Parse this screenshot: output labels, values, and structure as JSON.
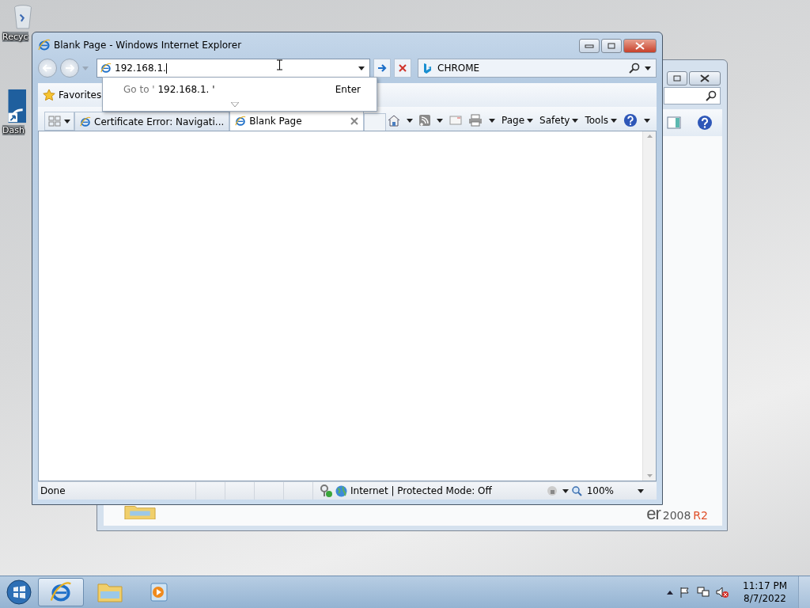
{
  "desktop": {
    "icons": [
      {
        "kind": "recycle",
        "label": "Recyc"
      },
      {
        "kind": "dashboard",
        "label": "Dash"
      }
    ]
  },
  "background_window": {
    "logo": {
      "partial_word": "er",
      "version": "2008",
      "release": "R2"
    }
  },
  "browser": {
    "title": "Blank Page - Windows Internet Explorer",
    "address": {
      "value": "192.168.1."
    },
    "suggestion": {
      "prefix": "Go to '",
      "address": "192.168.1. '",
      "hint": "Enter"
    },
    "search": {
      "value": "CHROME"
    },
    "favorites": "Favorites",
    "tabs": [
      {
        "label": "Certificate Error: Navigati...",
        "selected": false
      },
      {
        "label": "Blank Page",
        "selected": true
      }
    ],
    "commands": [
      "Page",
      "Safety",
      "Tools"
    ],
    "status": {
      "text": "Done",
      "zone": "Internet | Protected Mode: Off",
      "zoom": "100%"
    }
  },
  "taskbar": {
    "items": [
      {
        "kind": "browser",
        "selected": true
      },
      {
        "kind": "folder",
        "selected": false
      },
      {
        "kind": "media",
        "selected": false
      }
    ],
    "clock": {
      "time": "11:17 PM",
      "date": "8/7/2022"
    }
  }
}
